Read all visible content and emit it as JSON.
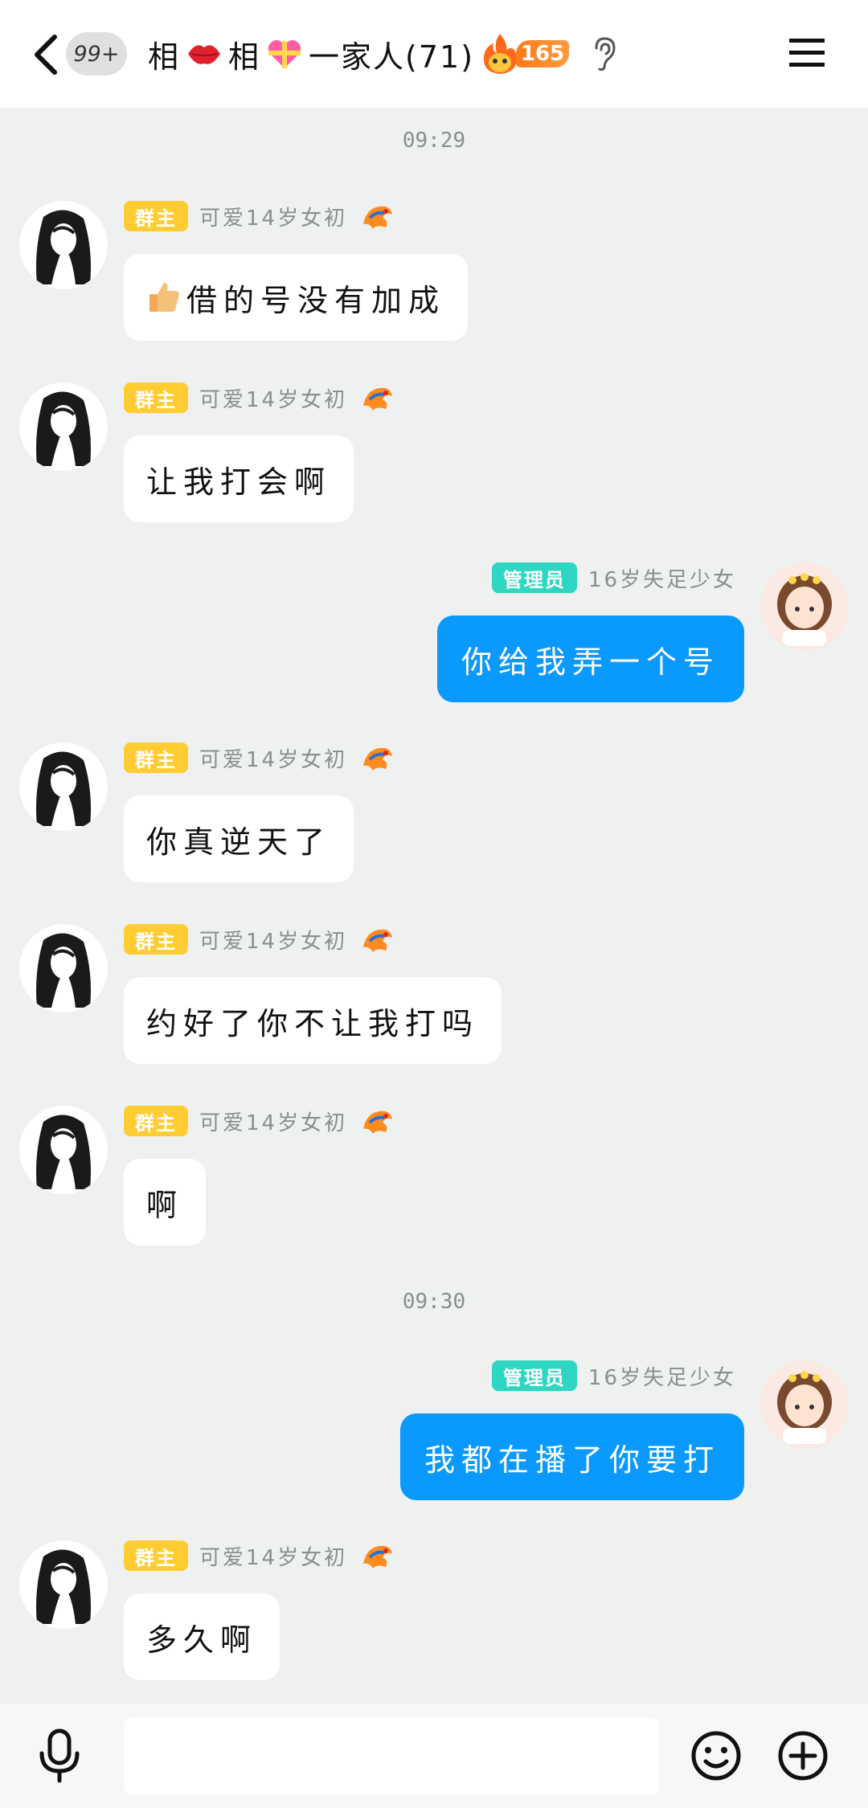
{
  "header": {
    "unread_count": "99+",
    "title_part1": "相",
    "title_part2": "相",
    "title_part3": "一家人(71)",
    "fire_count": "165"
  },
  "timestamps": [
    "09:29",
    "09:30"
  ],
  "roles": {
    "owner": "群主",
    "admin": "管理员"
  },
  "senders": {
    "owner_name": "可爱14岁女初",
    "admin_name": "16岁失足少女"
  },
  "messages": [
    {
      "side": "left",
      "text": "借的号没有加成",
      "has_thumb": true
    },
    {
      "side": "left",
      "text": "让我打会啊"
    },
    {
      "side": "right",
      "text": "你给我弄一个号"
    },
    {
      "side": "left",
      "text": "你真逆天了"
    },
    {
      "side": "left",
      "text": "约好了你不让我打吗"
    },
    {
      "side": "left",
      "text": "啊"
    },
    {
      "side": "right",
      "text": "我都在播了你要打"
    },
    {
      "side": "left",
      "text": "多久啊"
    }
  ],
  "input": {
    "placeholder": ""
  },
  "colors": {
    "background": "#eef1ef",
    "owner_badge": "#ffcc33",
    "admin_badge": "#2fd6c2",
    "self_bubble": "#0a99ff",
    "fire_badge": "#ff7a1a"
  },
  "icons": [
    "back-icon",
    "lips-emoji",
    "heart-gift-emoji",
    "fire-icon",
    "ear-icon",
    "menu-icon",
    "thumbs-up-emoji",
    "dragon-icon",
    "microphone-icon",
    "smiley-icon",
    "plus-circle-icon"
  ]
}
